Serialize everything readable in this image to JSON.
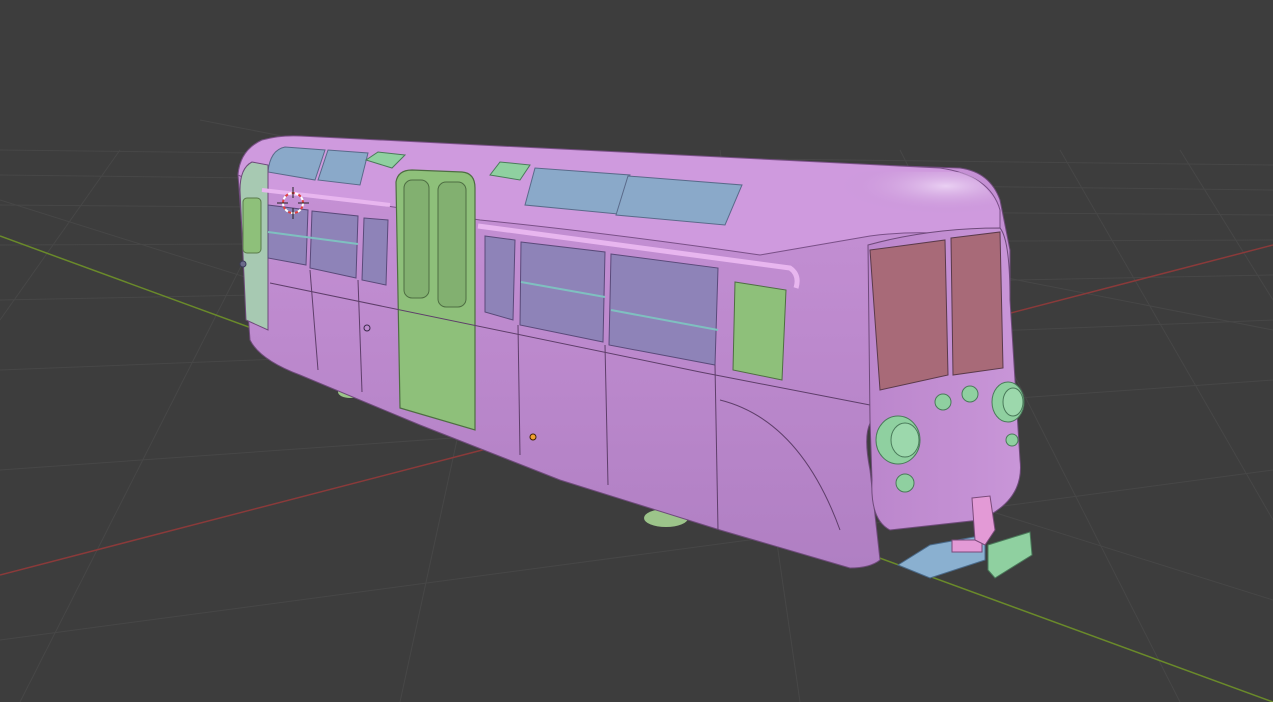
{
  "viewport": {
    "background": "#3d3d3d",
    "grid_color": "#484848",
    "x_axis_color": "#8a3a3a",
    "y_axis_color": "#6a8a2a"
  },
  "model": {
    "body_color": "#c48fd4",
    "body_shade": "#a978bd",
    "roof_color": "#cf9ade",
    "glass_color": "#8aa9c9",
    "door_color": "#8ec07a",
    "front_glass_color": "#a86a78",
    "accent_green": "#8fd0a0",
    "bumper_color": "#8ab0d0",
    "coupler_color": "#e39ad6"
  },
  "overlays": {
    "cursor_icon": "3d-cursor-icon",
    "origin_icon": "object-origin-icon"
  }
}
